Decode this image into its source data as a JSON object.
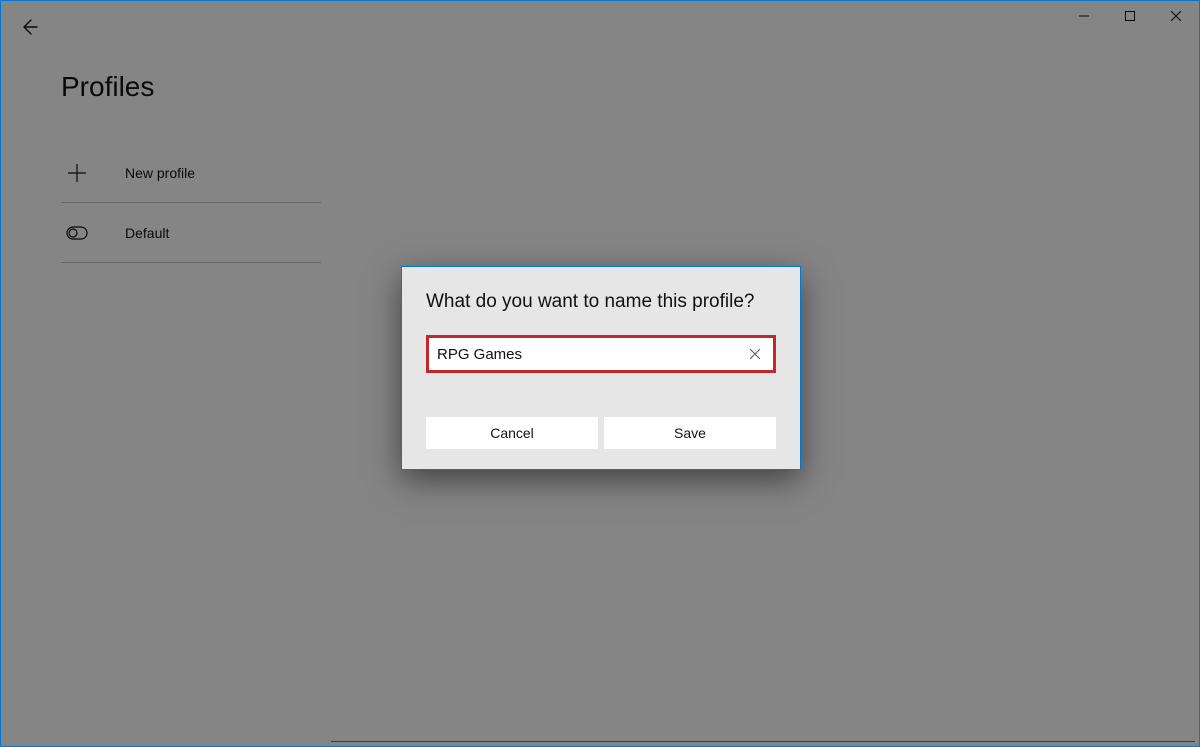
{
  "header": {
    "page_title": "Profiles"
  },
  "sidebar": {
    "items": [
      {
        "label": "New profile",
        "icon": "plus"
      },
      {
        "label": "Default",
        "icon": "toggle"
      }
    ]
  },
  "dialog": {
    "title": "What do you want to name this profile?",
    "input_value": "RPG Games",
    "cancel_label": "Cancel",
    "save_label": "Save",
    "highlight_color": "#c1272d"
  },
  "colors": {
    "accent": "#0078d7"
  }
}
